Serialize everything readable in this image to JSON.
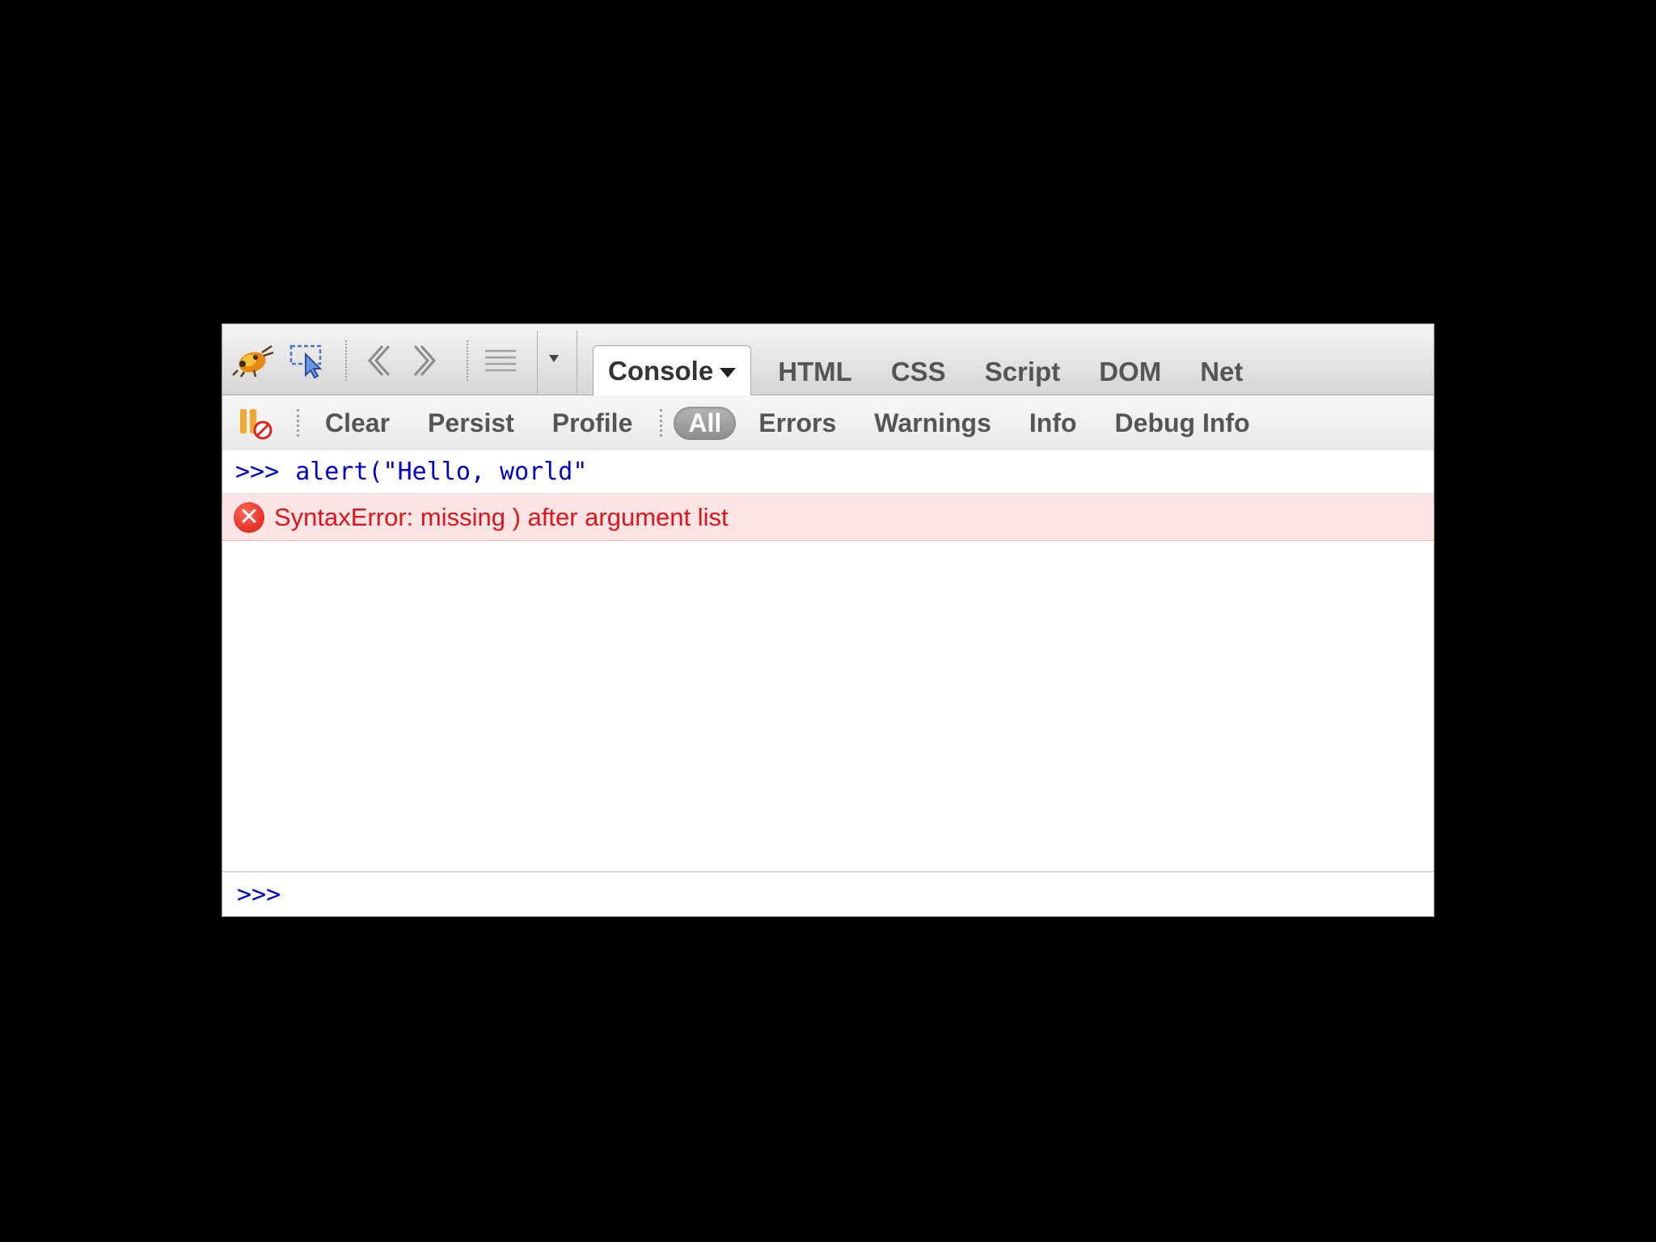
{
  "toolbar": {
    "icons": {
      "firebug": "firebug-bug-icon",
      "inspect": "inspect-pointer-icon",
      "back": "chevron-left-icon",
      "forward": "chevron-right-icon",
      "menu": "list-menu-icon"
    },
    "tabs": [
      {
        "label": "Console",
        "active": true
      },
      {
        "label": "HTML"
      },
      {
        "label": "CSS"
      },
      {
        "label": "Script"
      },
      {
        "label": "DOM"
      },
      {
        "label": "Net"
      }
    ]
  },
  "console_toolbar": {
    "items": [
      {
        "label": "Clear"
      },
      {
        "label": "Persist"
      },
      {
        "label": "Profile"
      }
    ],
    "filters": [
      {
        "label": "All",
        "active": true
      },
      {
        "label": "Errors"
      },
      {
        "label": "Warnings"
      },
      {
        "label": "Info"
      },
      {
        "label": "Debug Info"
      }
    ]
  },
  "log": {
    "command": {
      "prompt": ">>>",
      "text": "alert(\"Hello, world\""
    },
    "error": {
      "text": "SyntaxError: missing ) after argument list"
    }
  },
  "command_line": {
    "prompt": ">>>",
    "value": ""
  },
  "colors": {
    "error": "#e0141b",
    "error_bg": "#fde4e4",
    "command": "#0000cc"
  }
}
